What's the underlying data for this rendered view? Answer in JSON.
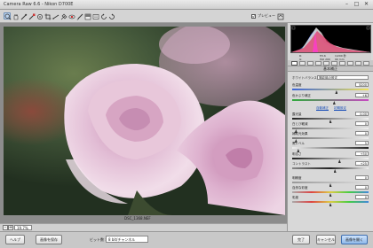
{
  "app": {
    "title": "Camera Raw 6.6  -  Nikon D700E",
    "window_controls": {
      "minimize": "–",
      "maximize": "□",
      "close": "✕"
    }
  },
  "toolbar": {
    "tools": [
      "zoom-icon",
      "hand-icon",
      "white-balance-icon",
      "color-sampler-icon",
      "target-adjust-icon",
      "crop-icon",
      "straighten-icon",
      "spot-removal-icon",
      "red-eye-icon",
      "adjustment-brush-icon",
      "graduated-filter-icon",
      "preferences-icon",
      "rotate-ccw-icon",
      "rotate-cw-icon"
    ],
    "preview_label": "プレビュー",
    "preview_checked": true
  },
  "canvas": {
    "filename": "DSC_1368.NEF",
    "zoom_value": "19.7%"
  },
  "histogram": {
    "readout": {
      "r_label": "R:",
      "g_label": "G:",
      "b_label": "B:",
      "f_value": "f/5.6",
      "shutter": "1/200 秒",
      "iso": "ISO 200",
      "focal": "90 mm"
    }
  },
  "panel": {
    "title": "基本補正",
    "white_balance": {
      "label": "ホワイトバランス :",
      "value": "撮影時の設定"
    },
    "temperature": {
      "label": "色温度",
      "value": "5200",
      "pos": 0.58
    },
    "tint": {
      "label": "色かぶり補正",
      "value": "+6",
      "pos": 0.55
    },
    "links": {
      "auto": "自動補正",
      "default": "初期設定"
    },
    "exposure": {
      "label": "露光量",
      "value": "0.00",
      "pos": 0.5
    },
    "recovery": {
      "label": "白とび軽減",
      "value": "0",
      "pos": 0.05
    },
    "fill": {
      "label": "補助光効果",
      "value": "0",
      "pos": 0.05
    },
    "blacks": {
      "label": "黒レベル",
      "value": "5",
      "pos": 0.08
    },
    "brightness": {
      "label": "明るさ",
      "value": "+50",
      "pos": 0.62
    },
    "contrast": {
      "label": "コントラスト",
      "value": "+25",
      "pos": 0.56
    },
    "clarity": {
      "label": "明瞭度",
      "value": "0",
      "pos": 0.5
    },
    "vibrance": {
      "label": "自然な彩度",
      "value": "0",
      "pos": 0.5
    },
    "saturation": {
      "label": "彩度",
      "value": "0",
      "pos": 0.5
    }
  },
  "bottom": {
    "help": "ヘルプ",
    "save": "画像を保存",
    "bit_label": "ビット数 :",
    "bit_value": "8 bit/チャンネル",
    "done": "完了",
    "cancel": "キャンセル",
    "open": "画像を開く"
  },
  "colors": {
    "accent": "#3f6fb0",
    "panel_bg": "#d8d8d8",
    "rose": "#e7c8dc"
  }
}
